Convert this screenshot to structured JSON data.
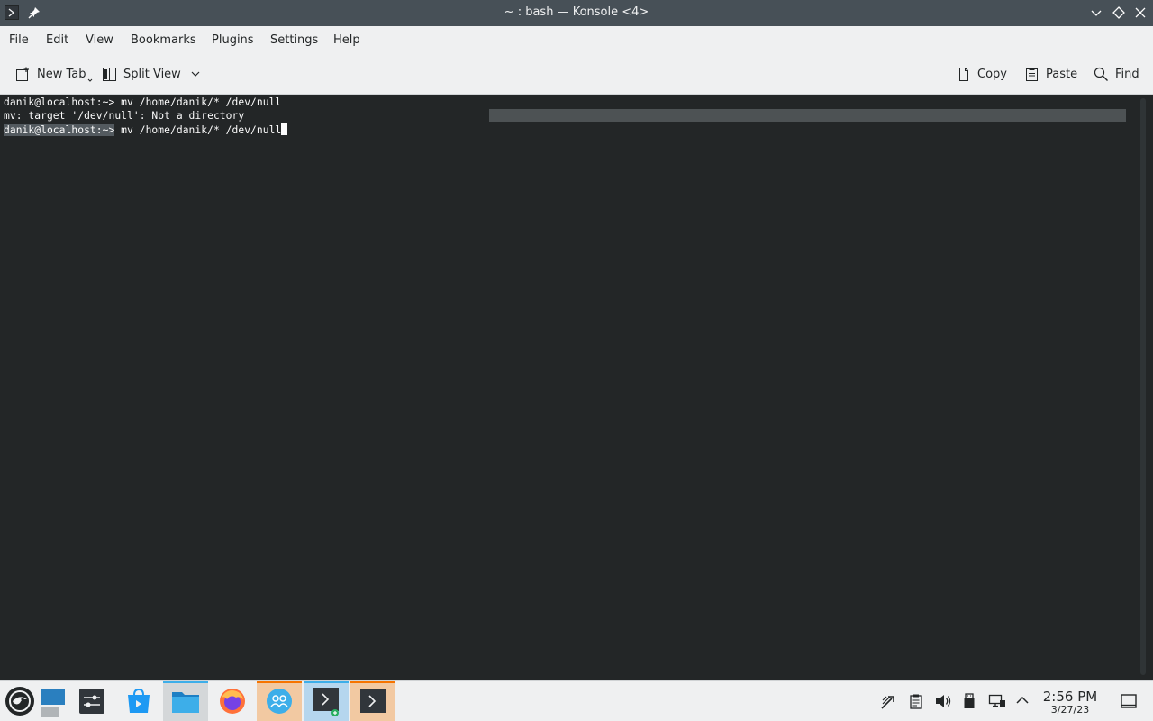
{
  "window": {
    "title": "~ : bash — Konsole <4>"
  },
  "menu": [
    "File",
    "Edit",
    "View",
    "Bookmarks",
    "Plugins",
    "Settings",
    "Help"
  ],
  "toolbar": {
    "new_tab": "New Tab",
    "split_view": "Split View",
    "copy": "Copy",
    "paste": "Paste",
    "find": "Find"
  },
  "terminal": {
    "line1": "danik@localhost:~> mv /home/danik/* /dev/null",
    "line2": "mv: target '/dev/null': Not a directory",
    "line3_prompt": "danik@localhost:~>",
    "line3_cmd": " mv /home/danik/* /dev/null"
  },
  "taskbar": {
    "icons": [
      "opensuse-menu-icon",
      "desktop-icon",
      "settings-icon",
      "discover-icon",
      "dolphin-icon",
      "firefox-icon",
      "people-icon",
      "konsole-icon",
      "konsole-icon"
    ]
  },
  "clock": {
    "time": "2:56 PM",
    "date": "3/27/23"
  },
  "colors": {
    "titlebar": "#475057",
    "background": "#232627",
    "accent": "#3daee9",
    "active_orange": "#f2c9a2"
  }
}
